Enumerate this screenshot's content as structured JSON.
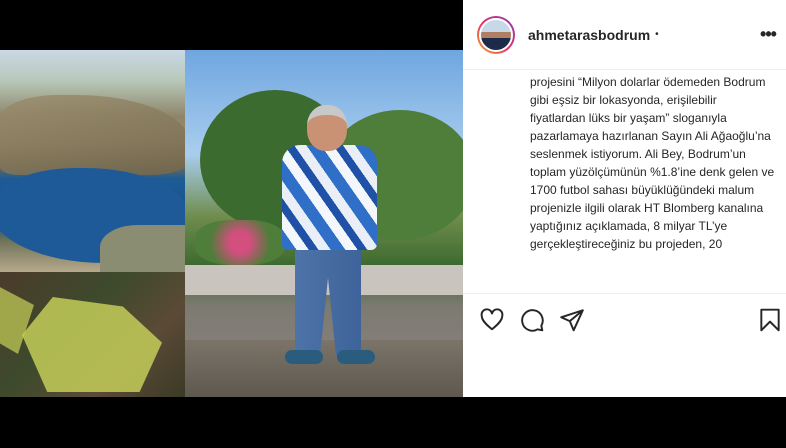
{
  "post": {
    "username": "ahmetarasbodrum",
    "separator": "•",
    "more_icon": "more-horizontal-icon",
    "caption": "projesini “Milyon dolarlar ödemeden Bodrum gibi eşsiz bir lokasyonda, erişilebilir fiyatlardan lüks bir yaşam” sloganıyla pazarlamaya hazırlanan Sayın Ali Ağaoğlu’na seslenmek istiyorum. Ali Bey, Bodrum’un toplam yüzölçümünün %1.8’ine denk gelen ve 1700 futbol sahası büyüklüğündeki malum projenizle ilgili olarak HT Blomberg kanalına yaptığınız açıklamada, 8 milyar TL’ye gerçekleştireceğiniz bu projeden, 20"
  },
  "actions": {
    "like_icon": "heart-icon",
    "comment_icon": "comment-icon",
    "share_icon": "paper-plane-icon",
    "save_icon": "bookmark-icon"
  },
  "colors": {
    "text": "#262626",
    "divider": "#efefef",
    "background": "#000000"
  }
}
